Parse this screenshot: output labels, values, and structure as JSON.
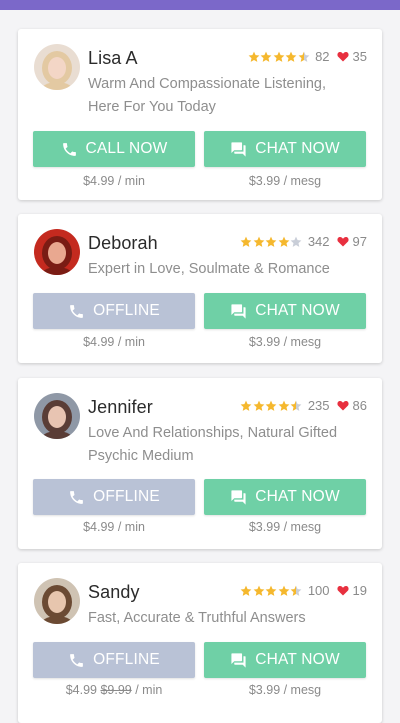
{
  "colors": {
    "topbar": "#7b68c9",
    "green": "#6fd0a6",
    "offline": "#b9c2d6",
    "star": "#f5b82e",
    "heart": "#e8303f"
  },
  "labels": {
    "call_now": "CALL NOW",
    "chat_now": "CHAT NOW",
    "offline": "OFFLINE"
  },
  "advisors": [
    {
      "name": "Lisa A",
      "rating": 4.5,
      "reviews": "82",
      "likes": "35",
      "tagline_1": "Warm And Compassionate Listening,",
      "tagline_2": "Here For You Today",
      "call_state": "call_now",
      "call_label": "CALL NOW",
      "chat_label": "CHAT NOW",
      "call_price": "$4.99 / min",
      "call_price_old": "",
      "chat_price": "$3.99 / mesg",
      "avatar": {
        "bg": "#e9ddd2",
        "hair": "#e3c9a2",
        "skin": "#f3d6c6"
      }
    },
    {
      "name": "Deborah",
      "rating": 4,
      "reviews": "342",
      "likes": "97",
      "tagline_1": "Expert in Love, Soulmate & Romance",
      "tagline_2": "",
      "call_state": "offline",
      "call_label": "OFFLINE",
      "chat_label": "CHAT NOW",
      "call_price": "$4.99 / min",
      "call_price_old": "",
      "chat_price": "$3.99 / mesg",
      "avatar": {
        "bg": "#c42a1f",
        "hair": "#7a1c14",
        "skin": "#e9a890"
      }
    },
    {
      "name": "Jennifer",
      "rating": 4.5,
      "reviews": "235",
      "likes": "86",
      "tagline_1": "Love And Relationships, Natural Gifted",
      "tagline_2": "Psychic Medium",
      "call_state": "offline",
      "call_label": "OFFLINE",
      "chat_label": "CHAT NOW",
      "call_price": "$4.99 / min",
      "call_price_old": "",
      "chat_price": "$3.99 / mesg",
      "avatar": {
        "bg": "#8f98a6",
        "hair": "#5a3d36",
        "skin": "#e8c4b2"
      }
    },
    {
      "name": "Sandy",
      "rating": 4.5,
      "reviews": "100",
      "likes": "19",
      "tagline_1": "Fast, Accurate & Truthful Answers",
      "tagline_2": "",
      "call_state": "offline",
      "call_label": "OFFLINE",
      "chat_label": "CHAT NOW",
      "call_price": "$4.99",
      "call_price_old": "$9.99",
      "call_price_unit": "/ min",
      "chat_price": "$3.99 / mesg",
      "avatar": {
        "bg": "#cfc3b3",
        "hair": "#6b4a33",
        "skin": "#e7c6ae"
      }
    }
  ]
}
